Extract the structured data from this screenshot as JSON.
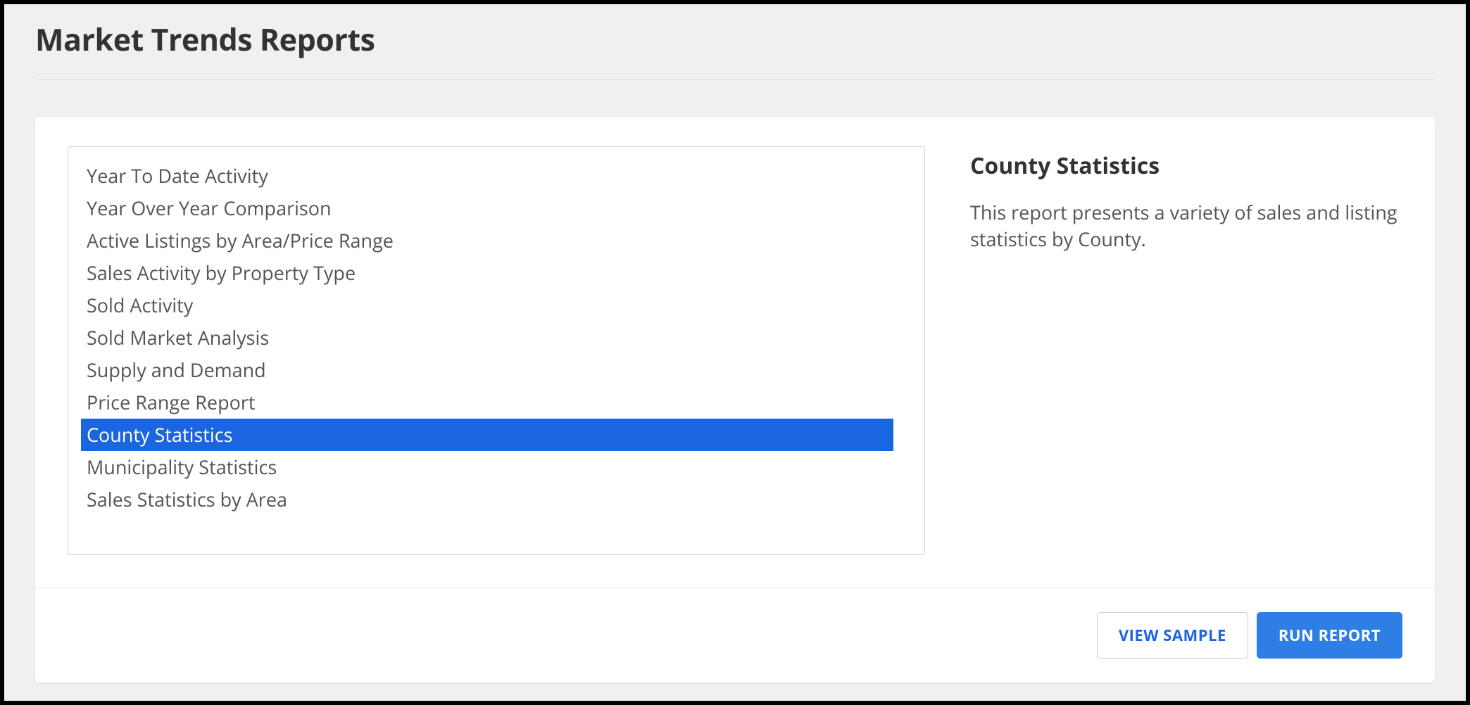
{
  "page": {
    "title": "Market Trends Reports"
  },
  "reports": {
    "items": [
      "Year To Date Activity",
      "Year Over Year Comparison",
      "Active Listings by Area/Price Range",
      "Sales Activity by Property Type",
      "Sold Activity",
      "Sold Market Analysis",
      "Supply and Demand",
      "Price Range Report",
      "County Statistics",
      "Municipality Statistics",
      "Sales Statistics by Area"
    ],
    "selected_index": 8
  },
  "detail": {
    "title": "County Statistics",
    "description": "This report presents a variety of sales and listing statistics by County."
  },
  "actions": {
    "view_sample": "VIEW SAMPLE",
    "run_report": "RUN REPORT"
  }
}
